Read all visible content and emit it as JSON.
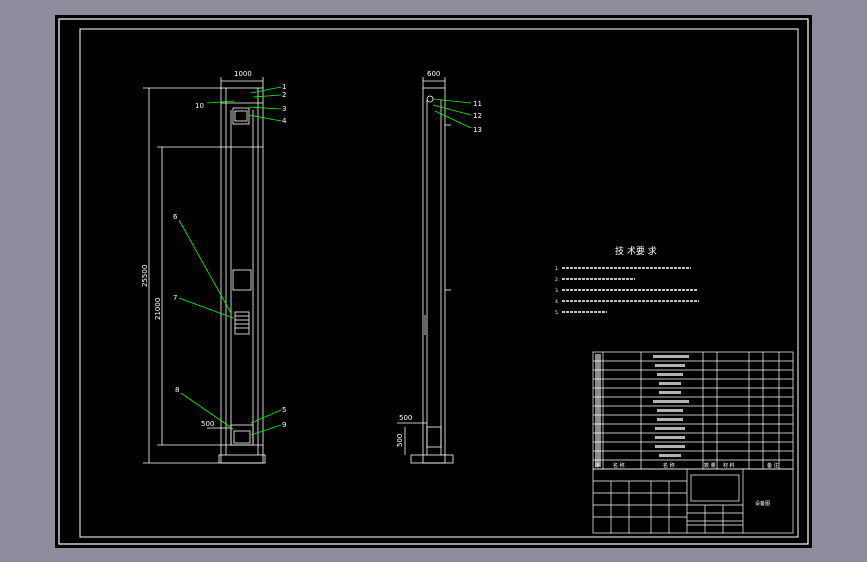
{
  "colors": {
    "background": "#8c8c9c",
    "sheet": "#000000",
    "line": "#ffffff",
    "leader": "#00ff00"
  },
  "front_view": {
    "width_dim": "1000",
    "height_dim_total": "25500",
    "height_dim_inner": "21000",
    "bottom_dim": "500",
    "labels": [
      "1",
      "2",
      "3",
      "4",
      "10",
      "6",
      "7",
      "8",
      "5",
      "9"
    ]
  },
  "side_view": {
    "width_dim": "600",
    "bottom_dim": "500",
    "bottom_dim_vertical": "500",
    "labels": [
      "11",
      "12",
      "13"
    ]
  },
  "tech_notes": {
    "title": "技 术要 求",
    "items": [
      "1.",
      "2.",
      "3.",
      "4.",
      "5."
    ]
  },
  "parts_list_header": [
    "序",
    "名 称",
    "名 称",
    "数 量",
    "材 料",
    "备 注"
  ],
  "title_block": {
    "drawing_name": "设备图"
  }
}
